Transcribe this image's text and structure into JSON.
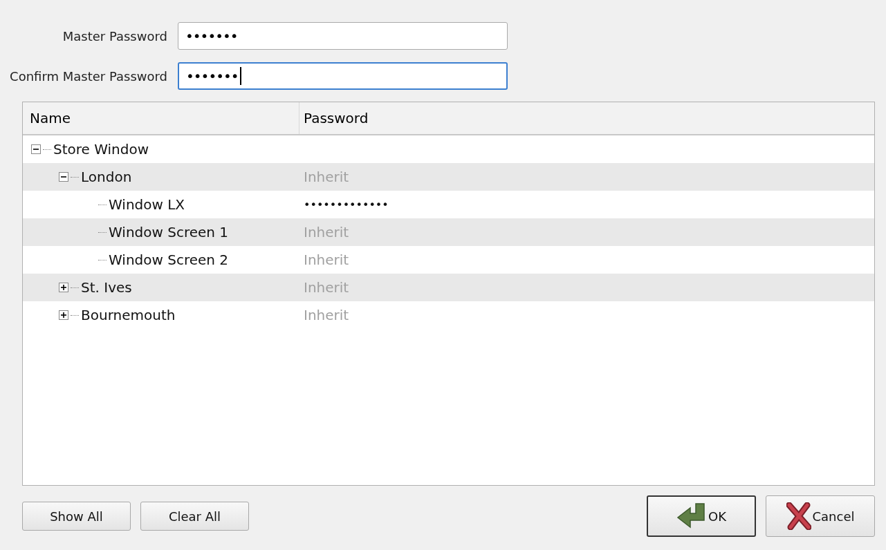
{
  "fields": [
    {
      "label": "Master Password",
      "value": "•••••••",
      "focused": false
    },
    {
      "label": "Confirm Master Password",
      "value": "•••••••",
      "focused": true
    }
  ],
  "tree": {
    "columns": [
      "Name",
      "Password"
    ],
    "items": [
      {
        "name": "Store Window",
        "expanded": true,
        "children": [
          {
            "name": "London",
            "password": "Inherit",
            "inherited": true,
            "expanded": true,
            "children": [
              {
                "name": "Window LX",
                "password": "•••••••••••••",
                "inherited": false
              },
              {
                "name": "Window Screen 1",
                "password": "Inherit",
                "inherited": true
              },
              {
                "name": "Window Screen 2",
                "password": "Inherit",
                "inherited": true
              }
            ]
          },
          {
            "name": "St. Ives",
            "password": "Inherit",
            "inherited": true,
            "expanded": false
          },
          {
            "name": "Bournemouth",
            "password": "Inherit",
            "inherited": true,
            "expanded": false
          }
        ]
      }
    ]
  },
  "left_buttons": [
    "Show All",
    "Clear All"
  ],
  "ok_button": "OK",
  "cancel_button": "Cancel"
}
